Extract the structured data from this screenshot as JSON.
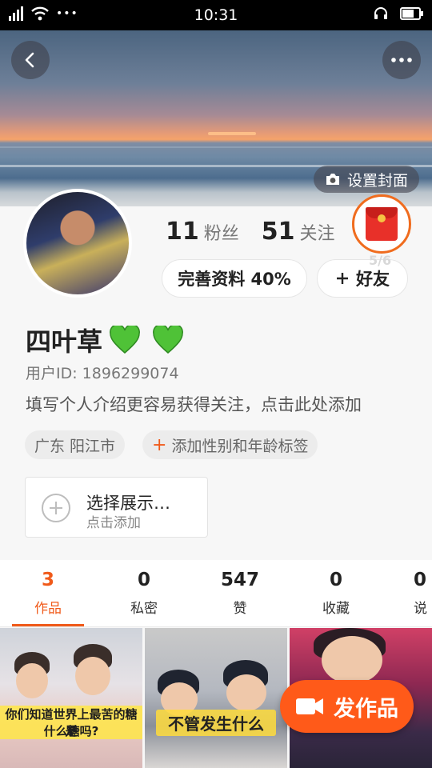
{
  "status_bar": {
    "time": "10:31",
    "menu_dots": "•••"
  },
  "cover": {
    "set_cover_label": "设置封面"
  },
  "profile": {
    "fans_count": "11",
    "fans_label": "粉丝",
    "following_count": "51",
    "following_label": "关注",
    "complete_profile_label": "完善资料 40%",
    "add_friend_label": "好友",
    "redpacket_count": "5/6",
    "username": "四叶草",
    "user_id": "用户ID: 1896299074",
    "bio": "填写个人介绍更容易获得关注，点击此处添加",
    "location_tag": "广东 阳江市",
    "add_tag_label": "添加性别和年龄标签",
    "showcase_title": "选择展示…",
    "showcase_sub": "点击添加"
  },
  "tabs": [
    {
      "count": "3",
      "label": "作品",
      "active": true
    },
    {
      "count": "0",
      "label": "私密"
    },
    {
      "count": "547",
      "label": "赞"
    },
    {
      "count": "0",
      "label": "收藏"
    },
    {
      "count": "0",
      "label": "说"
    }
  ],
  "grid": {
    "tile1_caption_line1": "你们知道世界上最苦的糖是",
    "tile1_caption_line2": "什么糖吗?",
    "tile2_caption": "不管发生什么"
  },
  "post_button_label": "发作品",
  "colors": {
    "accent": "#ff5a19",
    "tab_active": "#f05a1a",
    "redpacket": "#e83029"
  },
  "icons": [
    "signal-icon",
    "wifi-icon",
    "headset-icon",
    "battery-icon",
    "back-arrow-icon",
    "more-icon",
    "camera-icon",
    "heart-icon",
    "plus-icon",
    "video-camera-icon"
  ]
}
